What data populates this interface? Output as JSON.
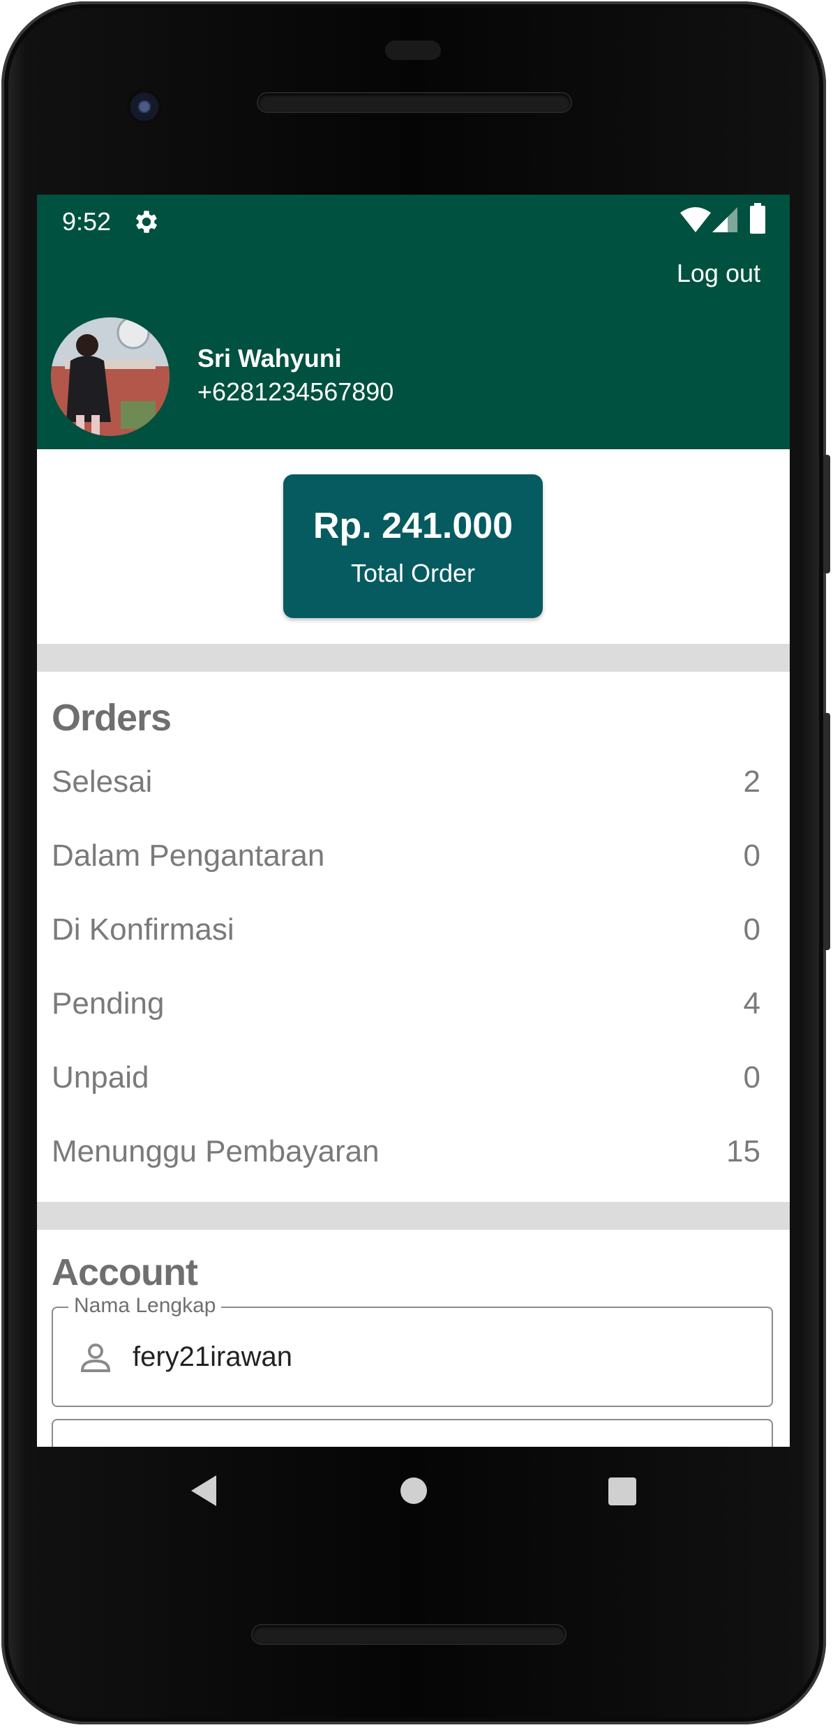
{
  "status_bar": {
    "time": "9:52"
  },
  "header": {
    "logout_label": "Log out",
    "user_name": "Sri Wahyuni",
    "user_phone": "+6281234567890"
  },
  "summary": {
    "total_amount": "Rp. 241.000",
    "total_label": "Total Order"
  },
  "orders": {
    "title": "Orders",
    "rows": [
      {
        "label": "Selesai",
        "count": "2"
      },
      {
        "label": "Dalam Pengantaran",
        "count": "0"
      },
      {
        "label": "Di Konfirmasi",
        "count": "0"
      },
      {
        "label": "Pending",
        "count": "4"
      },
      {
        "label": "Unpaid",
        "count": "0"
      },
      {
        "label": "Menunggu Pembayaran",
        "count": "15"
      }
    ]
  },
  "account": {
    "title": "Account",
    "name_field": {
      "legend": "Nama Lengkap",
      "value": "fery21irawan"
    }
  },
  "colors": {
    "header_bg": "#00513f",
    "card_bg": "#065b60",
    "divider": "#dcdcdc",
    "muted_text": "#7a7a7a"
  },
  "icons": {
    "status": [
      "gear-icon",
      "wifi-icon",
      "cell-signal-icon",
      "battery-icon"
    ],
    "field": "person-icon",
    "nav": [
      "back-icon",
      "home-icon",
      "recents-icon"
    ]
  }
}
